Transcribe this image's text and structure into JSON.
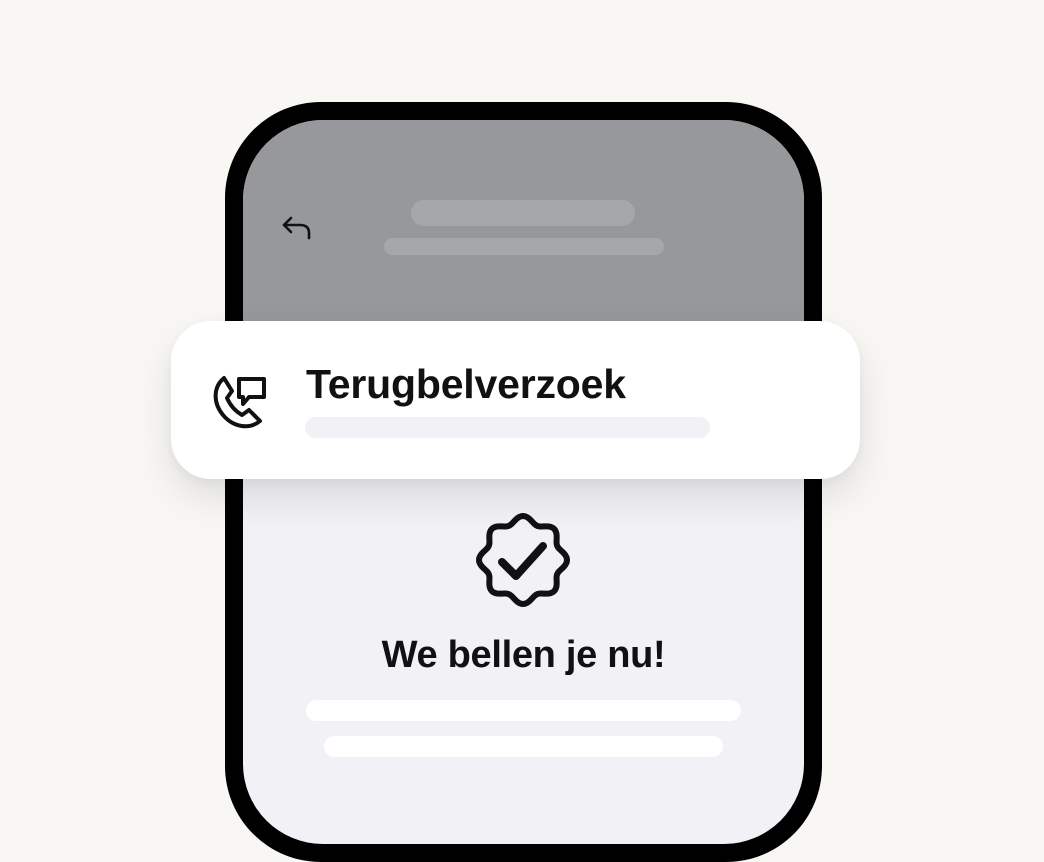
{
  "screen": {
    "back_icon": "back-arrow-icon",
    "confirmation": {
      "icon": "verified-badge-check-icon",
      "title": "We bellen je nu!"
    }
  },
  "card": {
    "icon": "phone-callback-icon",
    "title": "Terugbelverzoek"
  },
  "colors": {
    "background": "#f8f7f4",
    "phone_frame": "#000000",
    "screen_header": "#97989c",
    "screen_body": "#f2f1f6",
    "card": "#ffffff",
    "text": "#111111"
  }
}
